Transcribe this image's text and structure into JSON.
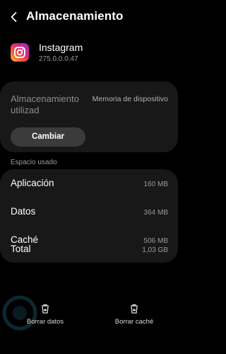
{
  "header": {
    "title": "Almacenamiento"
  },
  "app": {
    "name": "Instagram",
    "version": "275.0.0.0.47"
  },
  "storage": {
    "label": "Almacenamiento utilizad",
    "location": "Memoria de dispositivo",
    "change_button": "Cambiar"
  },
  "usage": {
    "section_title": "Espacio usado",
    "rows": [
      {
        "label": "Aplicación",
        "value": "160 MB"
      },
      {
        "label": "Datos",
        "value": "364 MB"
      },
      {
        "label": "Caché",
        "value": "506 MB"
      },
      {
        "label": "Total",
        "value": "1,03 GB"
      }
    ]
  },
  "actions": {
    "clear_data": {
      "label": "Borrar datos",
      "icon": "trash-lock-icon"
    },
    "clear_cache": {
      "label": "Borrar caché",
      "icon": "trash-lock-icon"
    }
  },
  "colors": {
    "background": "#000000",
    "card": "#181818",
    "button": "#3b3b3b",
    "muted_text": "#9a9a9a"
  }
}
